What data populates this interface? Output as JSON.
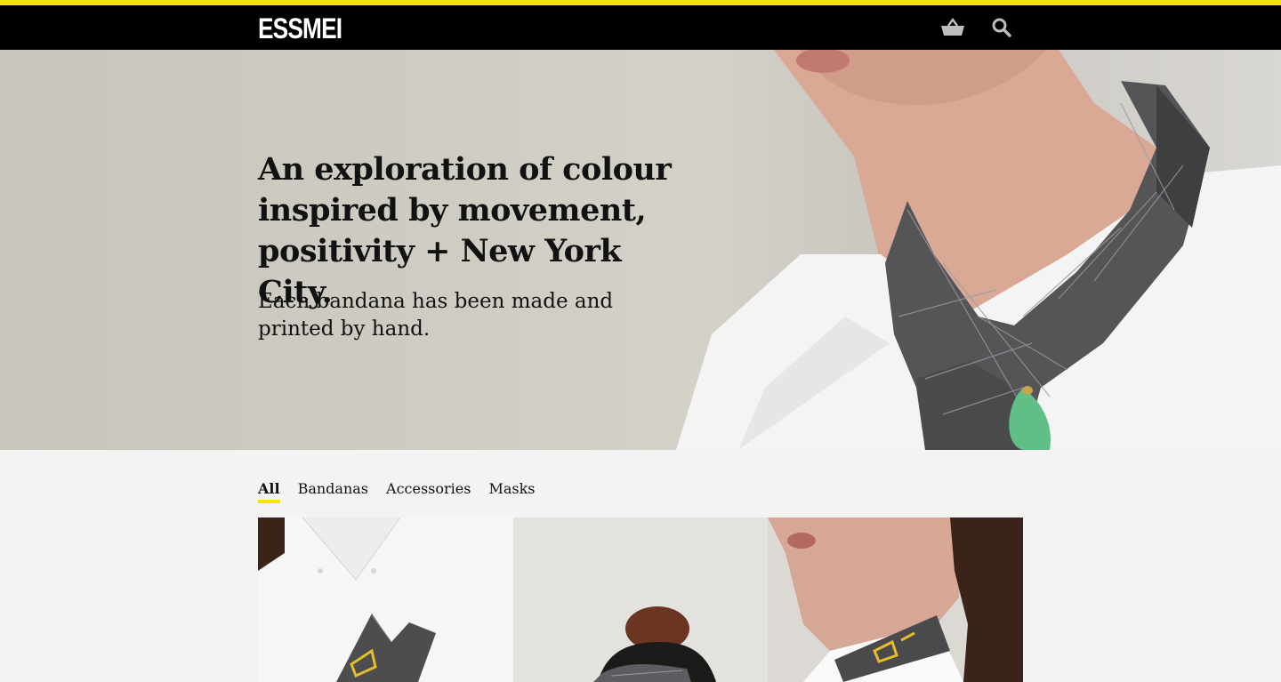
{
  "header": {
    "logo": "ESSMEI",
    "basket_icon": "basket-icon",
    "search_icon": "search-icon",
    "accent_color": "#f5e500"
  },
  "hero": {
    "title": "An exploration of colour inspired by movement, positivity + New York City.",
    "subtitle": "Each bandana has been made and printed by hand."
  },
  "filters": {
    "items": [
      {
        "label": "All",
        "active": true
      },
      {
        "label": "Bandanas",
        "active": false
      },
      {
        "label": "Accessories",
        "active": false
      },
      {
        "label": "Masks",
        "active": false
      }
    ]
  },
  "products": [
    {
      "name": "product-shirt-pocket-bandana"
    },
    {
      "name": "product-hair-bandana"
    },
    {
      "name": "product-neck-bandana"
    }
  ]
}
